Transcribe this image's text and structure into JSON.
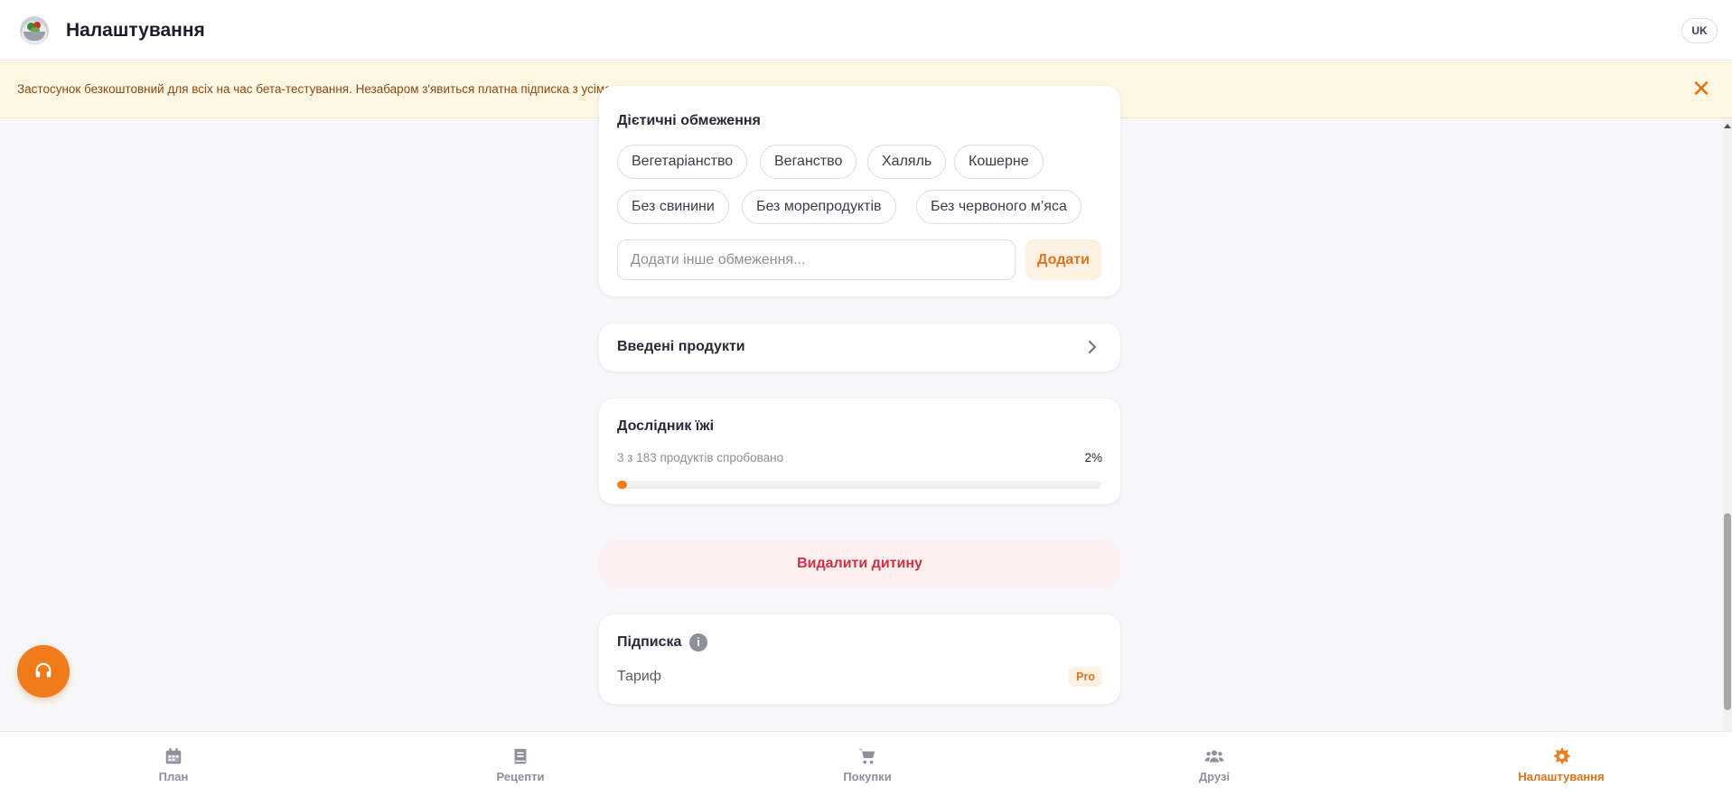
{
  "header": {
    "title": "Налаштування",
    "language": "UK"
  },
  "banner": {
    "text": "Застосунок безкоштовний для всіх на час бета-тестування. Незабаром з'явиться платна підписка з усіма можливостями."
  },
  "diet": {
    "heading": "Дієтичні обмеження",
    "chips": [
      "Вегетаріанство",
      "Веганство",
      "Халяль",
      "Кошерне",
      "Без свинини",
      "Без морепродуктів",
      "Без червоного м’яса"
    ],
    "input_placeholder": "Додати інше обмеження...",
    "add_label": "Додати"
  },
  "products": {
    "label": "Введені продукти"
  },
  "explorer": {
    "heading": "Дослідник їжі",
    "subtitle": "3 з 183 продуктів спробовано",
    "percent": "2%",
    "progress": 0.02
  },
  "delete": {
    "label": "Видалити дитину"
  },
  "subscription": {
    "heading": "Підписка",
    "tariff_label": "Тариф",
    "tariff_value": "Pro"
  },
  "nav": {
    "items": [
      {
        "label": "План",
        "icon": "calendar-icon",
        "active": false
      },
      {
        "label": "Рецепти",
        "icon": "book-icon",
        "active": false
      },
      {
        "label": "Покупки",
        "icon": "cart-icon",
        "active": false
      },
      {
        "label": "Друзі",
        "icon": "users-icon",
        "active": false
      },
      {
        "label": "Налаштування",
        "icon": "gear-icon",
        "active": true
      }
    ]
  },
  "colors": {
    "accent": "#f07b1a",
    "danger": "#d32f45",
    "banner_bg": "#fdf6e3"
  }
}
